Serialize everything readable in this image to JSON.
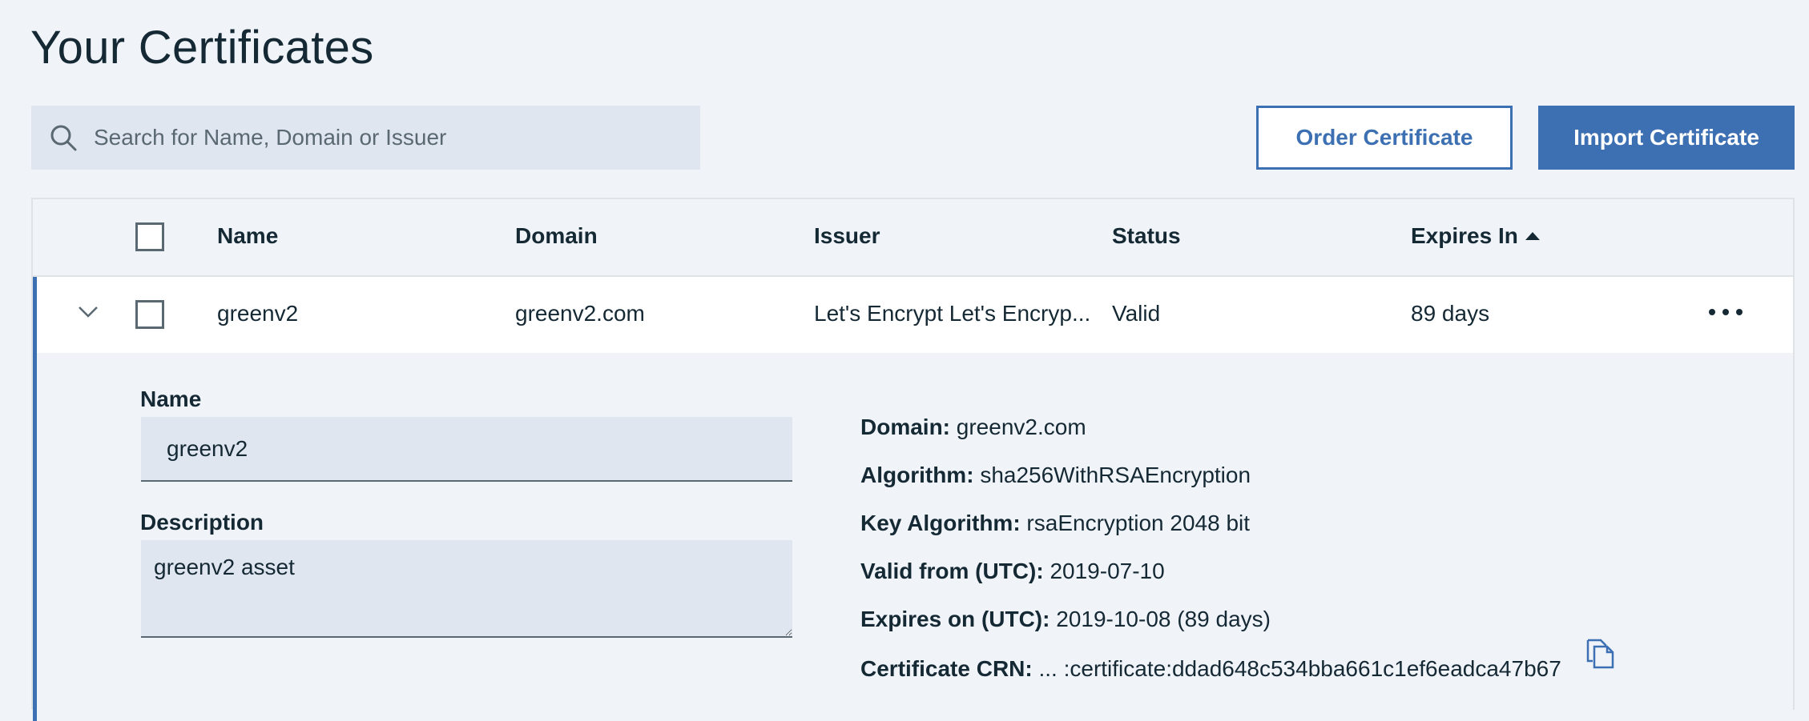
{
  "page": {
    "title": "Your Certificates"
  },
  "toolbar": {
    "search_placeholder": "Search for Name, Domain or Issuer",
    "search_icon": "search-icon",
    "order_label": "Order Certificate",
    "import_label": "Import Certificate"
  },
  "table": {
    "columns": [
      "Name",
      "Domain",
      "Issuer",
      "Status",
      "Expires In"
    ],
    "sort": {
      "column": "Expires In",
      "direction": "ascending"
    },
    "rows": [
      {
        "name": "greenv2",
        "domain": "greenv2.com",
        "issuer": "Let's Encrypt Let's Encryp...",
        "status": "Valid",
        "expires_in": "89 days",
        "expanded": true
      }
    ]
  },
  "details": {
    "name_label": "Name",
    "name_value": "greenv2",
    "description_label": "Description",
    "description_value": "greenv2 asset",
    "domain_label": "Domain:",
    "domain_value": "greenv2.com",
    "algorithm_label": "Algorithm:",
    "algorithm_value": "sha256WithRSAEncryption",
    "key_algorithm_label": "Key Algorithm:",
    "key_algorithm_value": "rsaEncryption 2048 bit",
    "valid_from_label": "Valid from (UTC):",
    "valid_from_value": "2019-07-10",
    "expires_on_label": "Expires on (UTC):",
    "expires_on_value": "2019-10-08 (89 days)",
    "crn_label": "Certificate CRN:",
    "crn_value": "... :certificate:ddad648c534bba661c1ef6eadca47b67"
  },
  "colors": {
    "accent": "#3d70b2",
    "background": "#f0f3f8",
    "field": "#dfe6f0",
    "text": "#152935"
  }
}
